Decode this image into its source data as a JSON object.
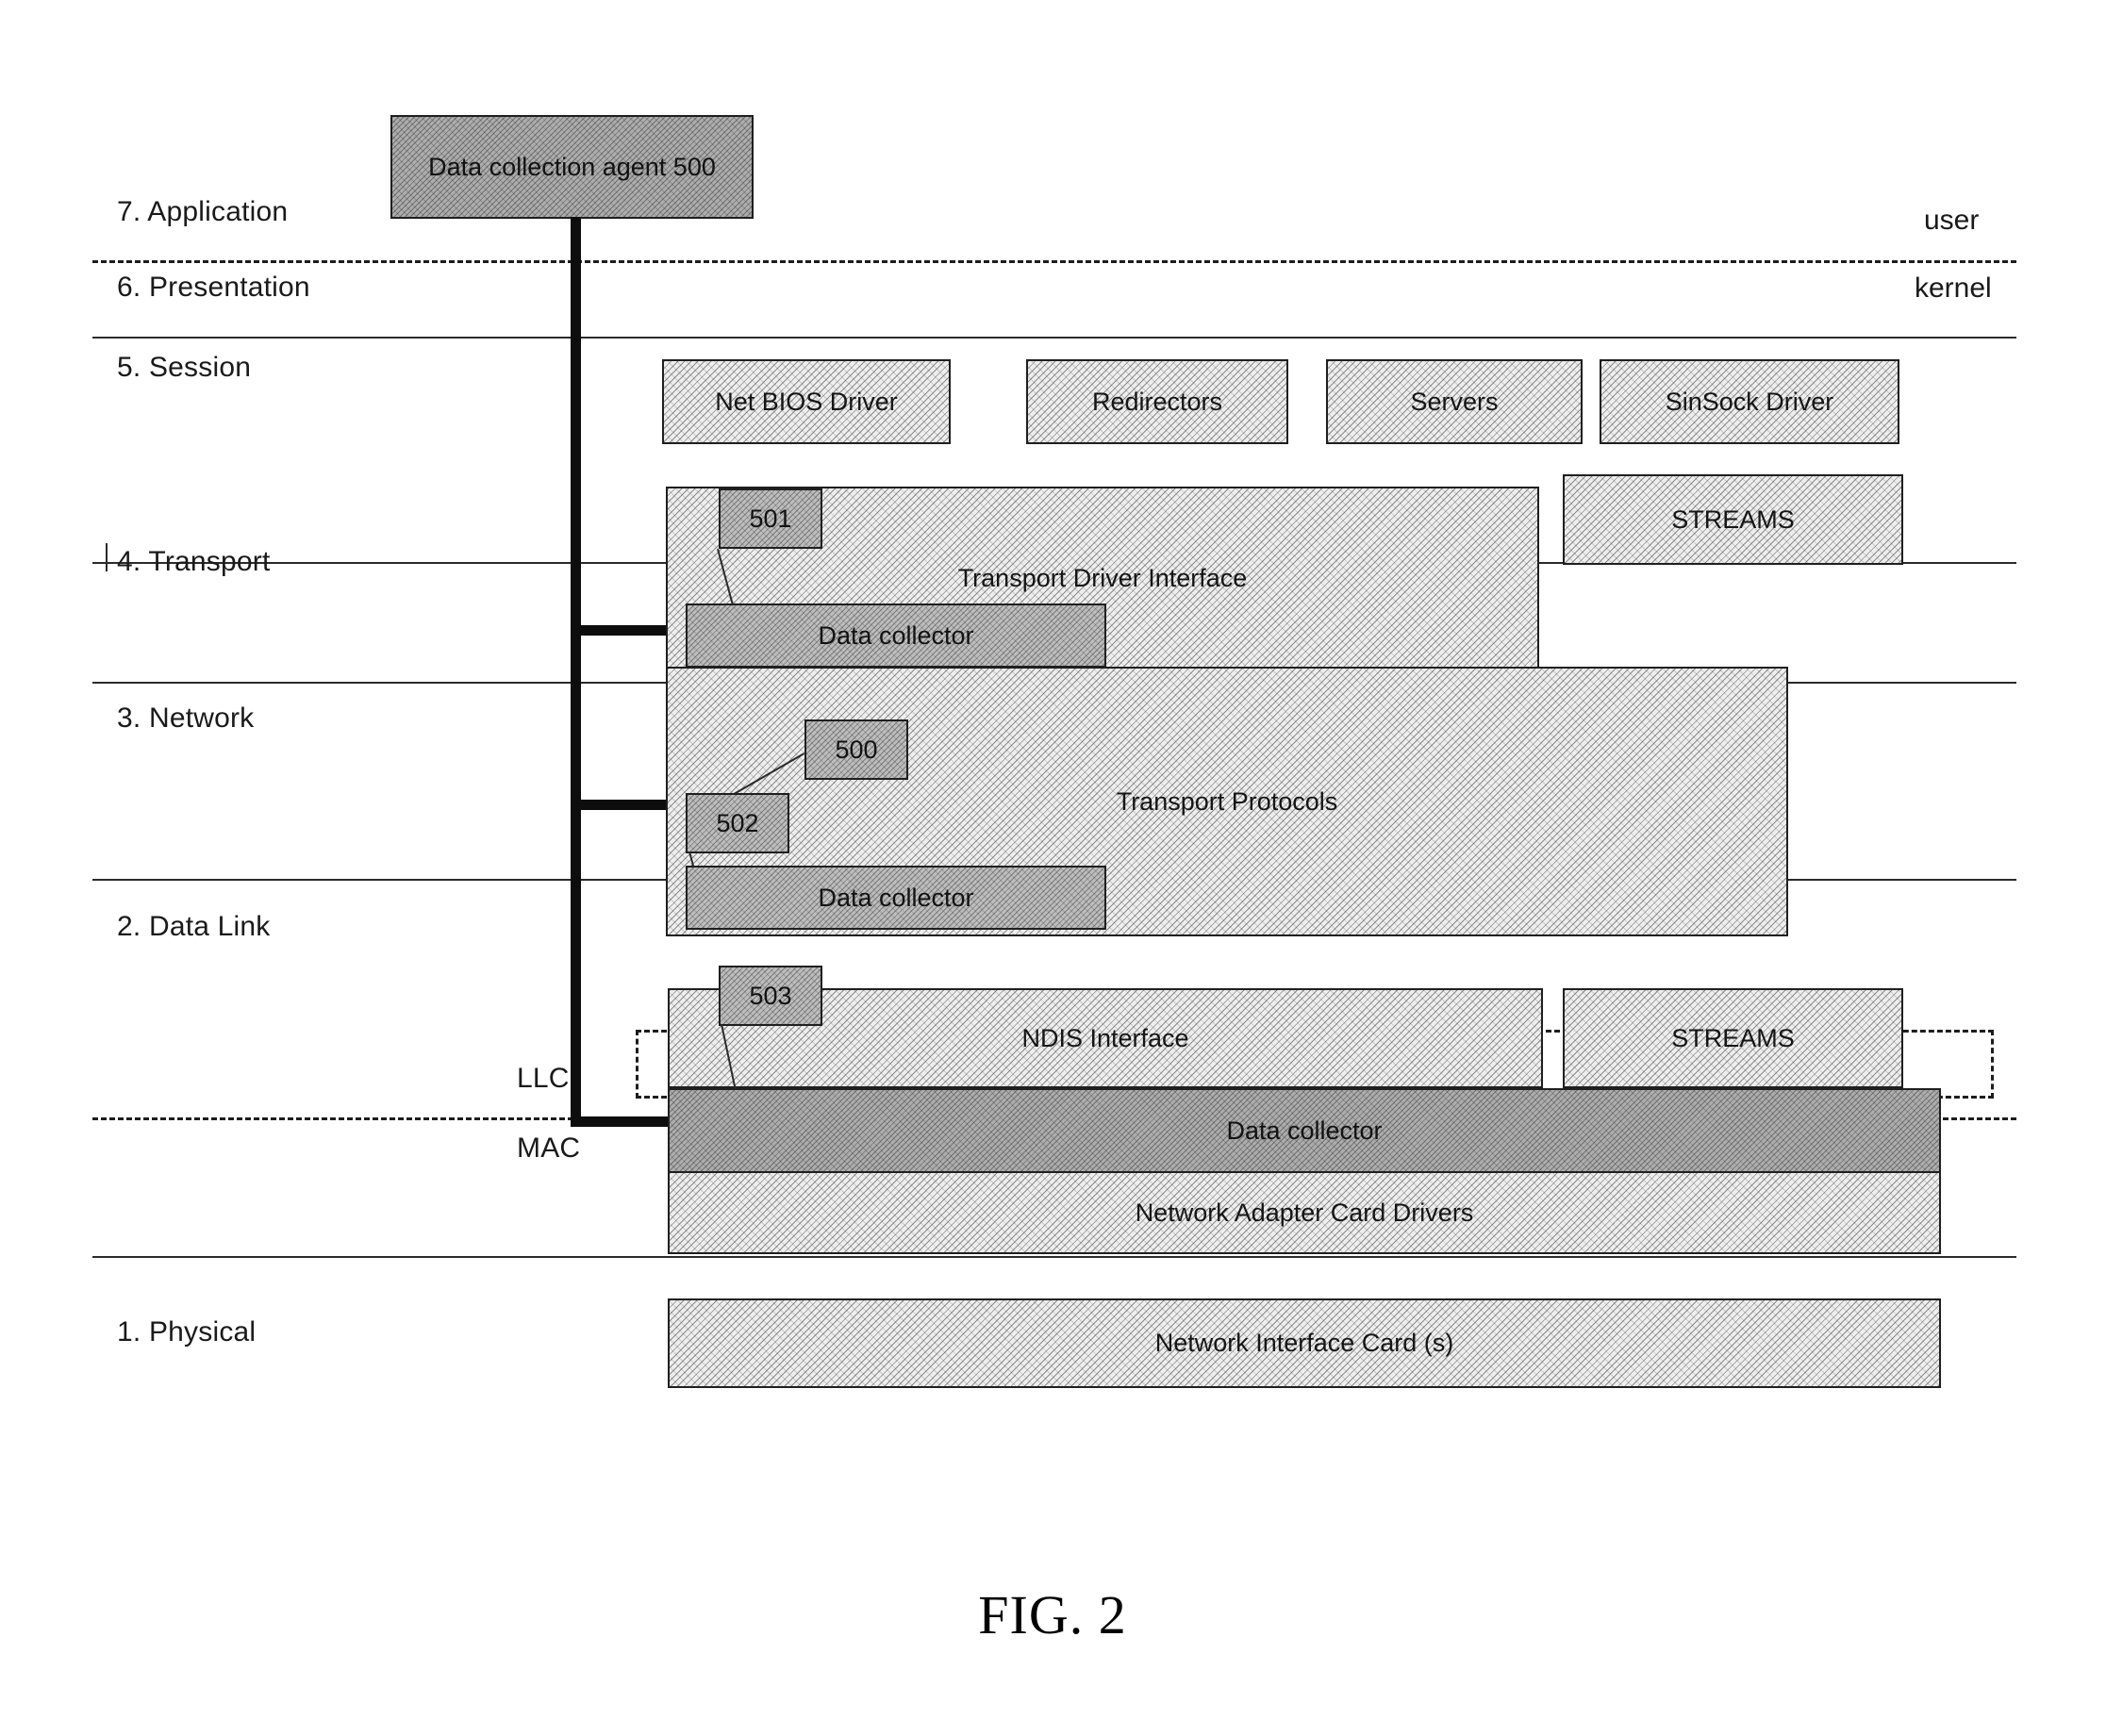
{
  "figure": {
    "caption": "FIG. 2"
  },
  "boundary_notes": {
    "user": "user",
    "kernel": "kernel"
  },
  "osi_layers": [
    {
      "number": "7",
      "label": "7. Application"
    },
    {
      "number": "6",
      "label": "6. Presentation"
    },
    {
      "number": "5",
      "label": "5. Session"
    },
    {
      "number": "4",
      "label": "4. Transport"
    },
    {
      "number": "3",
      "label": "3. Network"
    },
    {
      "number": "2",
      "label": "2. Data Link"
    },
    {
      "number": "1",
      "label": "1. Physical"
    }
  ],
  "sublayers": {
    "llc": "LLC",
    "mac": "MAC"
  },
  "agent": {
    "label": "Data collection agent 500"
  },
  "session_blocks": [
    {
      "label": "Net BIOS Driver"
    },
    {
      "label": "Redirectors"
    },
    {
      "label": "Servers"
    },
    {
      "label": "SinSock Driver"
    }
  ],
  "transport_area": {
    "tdi_label": "Transport Driver Interface",
    "tdi_ref": "501",
    "tdi_collector": "Data collector",
    "streams_label": "STREAMS"
  },
  "network_area": {
    "protocols_label": "Transport Protocols",
    "agent_ref": "500",
    "collector_ref": "502",
    "collector_label": "Data collector"
  },
  "datalink_area": {
    "ndis_label": "NDIS Interface",
    "ndis_ref": "503",
    "streams_label": "STREAMS",
    "collector_label": "Data collector",
    "drivers_label": "Network Adapter Card Drivers"
  },
  "physical_area": {
    "nic_label": "Network Interface Card (s)"
  }
}
